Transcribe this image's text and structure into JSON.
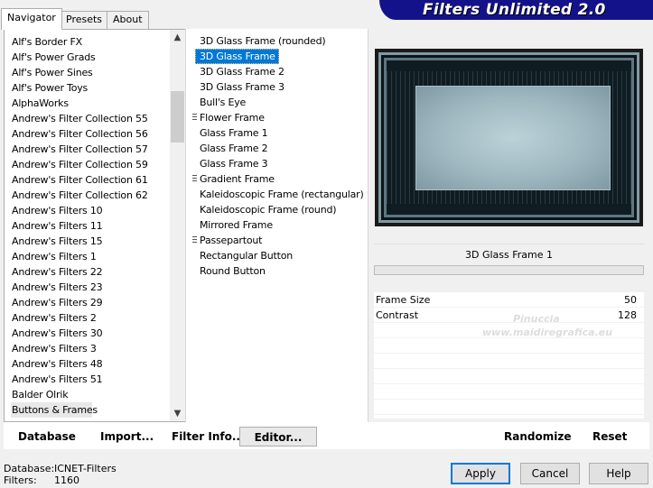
{
  "banner": {
    "title": "Filters Unlimited 2.0"
  },
  "tabs": [
    {
      "label": "Navigator",
      "active": true
    },
    {
      "label": "Presets",
      "active": false
    },
    {
      "label": "About",
      "active": false
    }
  ],
  "categories": {
    "selected": "Buttons & Frames",
    "items": [
      "Alf's Border FX",
      "Alf's Power Grads",
      "Alf's Power Sines",
      "Alf's Power Toys",
      "AlphaWorks",
      "Andrew's Filter Collection 55",
      "Andrew's Filter Collection 56",
      "Andrew's Filter Collection 57",
      "Andrew's Filter Collection 59",
      "Andrew's Filter Collection 61",
      "Andrew's Filter Collection 62",
      "Andrew's Filters 10",
      "Andrew's Filters 11",
      "Andrew's Filters 15",
      "Andrew's Filters 1",
      "Andrew's Filters 22",
      "Andrew's Filters 23",
      "Andrew's Filters 29",
      "Andrew's Filters 2",
      "Andrew's Filters 30",
      "Andrew's Filters 3",
      "Andrew's Filters 48",
      "Andrew's Filters 51",
      "Balder Olrik",
      "Buttons & Frames"
    ],
    "scroll_position": 0.15
  },
  "filters": {
    "selected": "3D Glass Frame 1",
    "items": [
      {
        "label": "3D Glass Frame (rounded)",
        "grip": false
      },
      {
        "label": "3D Glass Frame 1",
        "grip": false
      },
      {
        "label": "3D Glass Frame 2",
        "grip": false
      },
      {
        "label": "3D Glass Frame 3",
        "grip": false
      },
      {
        "label": "Bull's Eye",
        "grip": false
      },
      {
        "label": "Flower Frame",
        "grip": true
      },
      {
        "label": "Glass Frame 1",
        "grip": false
      },
      {
        "label": "Glass Frame 2",
        "grip": false
      },
      {
        "label": "Glass Frame 3",
        "grip": false
      },
      {
        "label": "Gradient Frame",
        "grip": true
      },
      {
        "label": "Kaleidoscopic Frame (rectangular)",
        "grip": false
      },
      {
        "label": "Kaleidoscopic Frame (round)",
        "grip": false
      },
      {
        "label": "Mirrored Frame",
        "grip": false
      },
      {
        "label": "Passepartout",
        "grip": true
      },
      {
        "label": "Rectangular Button",
        "grip": false
      },
      {
        "label": "Round Button",
        "grip": false
      }
    ]
  },
  "preview": {
    "filter_name": "3D Glass Frame 1"
  },
  "params": [
    {
      "label": "Frame Size",
      "value": "50"
    },
    {
      "label": "Contrast",
      "value": "128"
    }
  ],
  "watermark": {
    "line1": "Pinuccia",
    "line2": "www.maidiregrafica.eu"
  },
  "bottom_buttons": {
    "database": "Database",
    "import": "Import...",
    "filter_info": "Filter Info...",
    "editor": "Editor...",
    "randomize": "Randomize",
    "reset": "Reset"
  },
  "status": {
    "database_label": "Database:",
    "database_value": "ICNET-Filters",
    "filters_label": "Filters:",
    "filters_value": "1160"
  },
  "dialog_buttons": {
    "apply": "Apply",
    "cancel": "Cancel",
    "help": "Help"
  }
}
